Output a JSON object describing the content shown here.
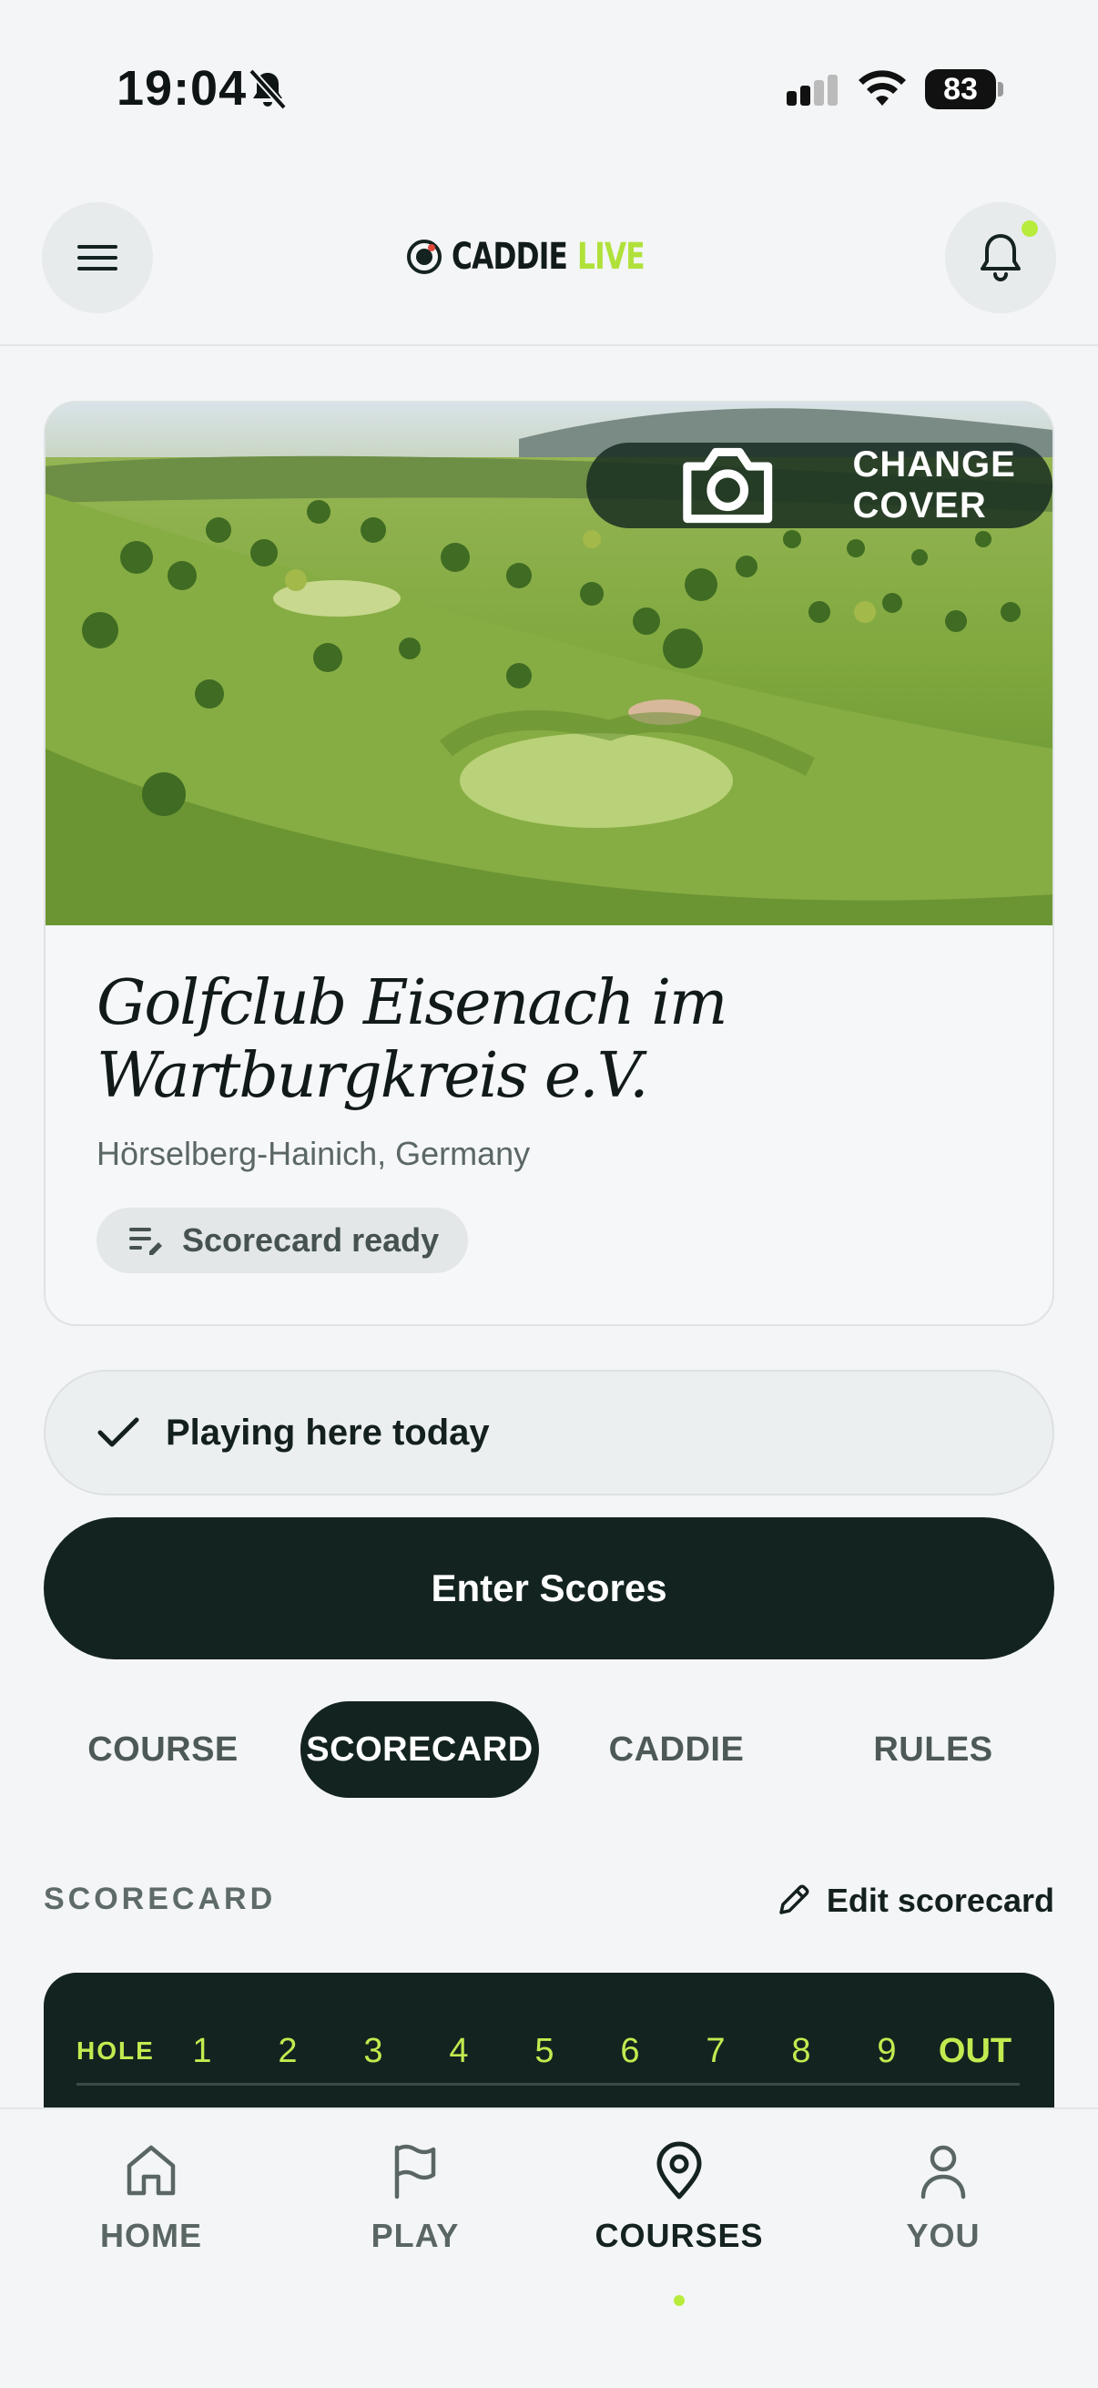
{
  "status_bar": {
    "time": "19:04",
    "battery": "83",
    "icons": [
      "bell-slash-icon",
      "cellular-signal-icon",
      "wifi-icon",
      "battery-icon"
    ]
  },
  "header": {
    "logo_word": "CADDIE",
    "logo_live": "LIVE",
    "menu_icon": "hamburger-menu-icon",
    "notifications_icon": "bell-icon",
    "has_unread": true
  },
  "course": {
    "change_cover_label": "CHANGE COVER",
    "name_line1": "Golfclub Eisenach im",
    "name_line2": "Wartburgkreis e.V.",
    "location": "Hörselberg-Hainich, Germany",
    "status_badge": "Scorecard ready"
  },
  "actions": {
    "playing_today": "Playing here today",
    "enter_scores": "Enter Scores"
  },
  "tabs": [
    {
      "label": "COURSE",
      "active": false
    },
    {
      "label": "SCORECARD",
      "active": true
    },
    {
      "label": "CADDIE",
      "active": false
    },
    {
      "label": "RULES",
      "active": false
    }
  ],
  "scorecard": {
    "section_title": "SCORECARD",
    "edit_label": "Edit scorecard",
    "hole_label": "HOLE",
    "holes": [
      "1",
      "2",
      "3",
      "4",
      "5",
      "6",
      "7",
      "8",
      "9"
    ],
    "out_label": "OUT"
  },
  "bottom_nav": [
    {
      "label": "HOME",
      "icon": "home-icon",
      "active": false
    },
    {
      "label": "PLAY",
      "icon": "flag-icon",
      "active": false
    },
    {
      "label": "COURSES",
      "icon": "map-pin-icon",
      "active": true
    },
    {
      "label": "YOU",
      "icon": "user-icon",
      "active": false
    }
  ],
  "colors": {
    "accent": "#b8ec3c",
    "dark": "#132320",
    "background": "#f3f5f6"
  }
}
